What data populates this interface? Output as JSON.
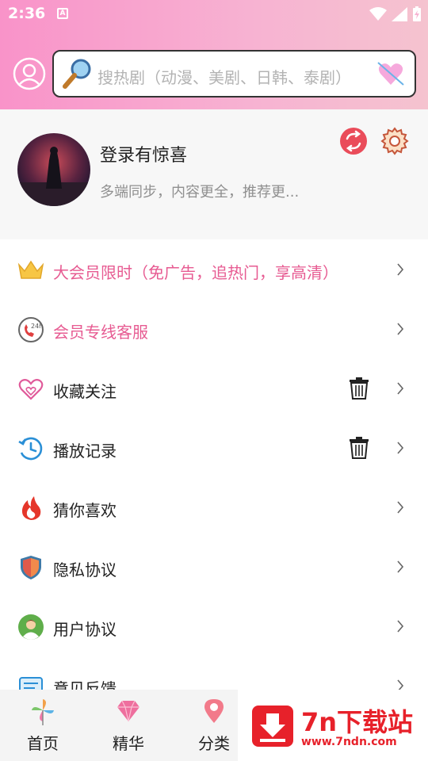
{
  "status_bar": {
    "time": "2:36",
    "notif_letter": "A"
  },
  "search": {
    "placeholder": "搜热剧（动漫、美剧、日韩、泰剧）"
  },
  "profile": {
    "name": "登录有惊喜",
    "subtitle": "多端同步，内容更全，推荐更..."
  },
  "menu": [
    {
      "label": "大会员限时（免广告，追热门，享高清）",
      "icon": "crown-icon"
    },
    {
      "label": "会员专线客服",
      "icon": "phone-24h-icon"
    },
    {
      "label": "收藏关注",
      "icon": "heart-icon"
    },
    {
      "label": "播放记录",
      "icon": "history-clock-icon"
    },
    {
      "label": "猜你喜欢",
      "icon": "flame-icon"
    },
    {
      "label": "隐私协议",
      "icon": "shield-icon"
    },
    {
      "label": "用户协议",
      "icon": "user-icon"
    },
    {
      "label": "意见反馈",
      "icon": "feedback-icon"
    }
  ],
  "bottom_nav": [
    {
      "label": "首页",
      "icon": "pinwheel-icon"
    },
    {
      "label": "精华",
      "icon": "diamond-icon"
    },
    {
      "label": "分类",
      "icon": "location-pin-icon"
    }
  ],
  "watermark": {
    "title": "7n下载站",
    "url": "www.7ndn.com"
  },
  "colors": {
    "header_start": "#f993c9",
    "header_end": "#f5c3cf",
    "accent_pink": "#e75b92",
    "watermark_red": "#e7212a"
  }
}
